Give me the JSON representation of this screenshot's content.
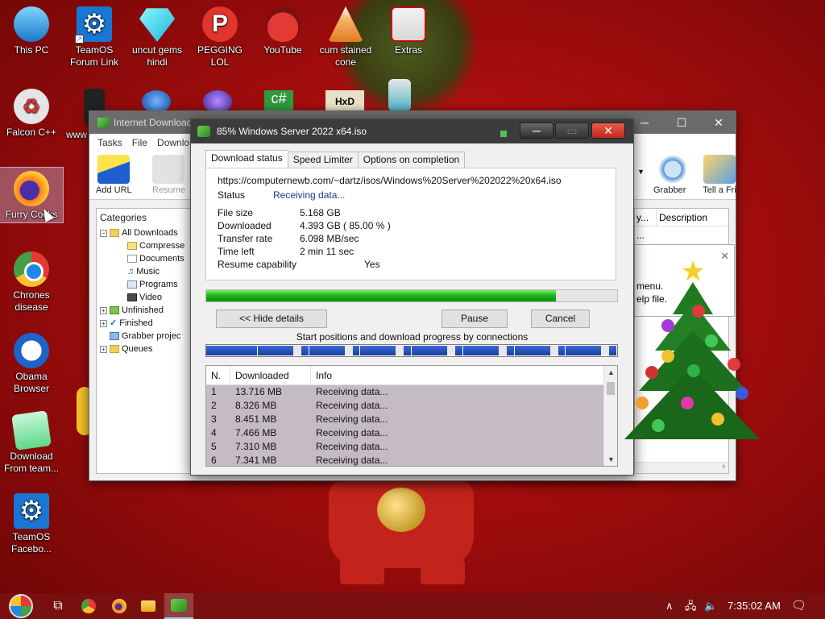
{
  "desktop": {
    "icons": [
      {
        "label": "This PC"
      },
      {
        "label": "TeamOS Forum Link"
      },
      {
        "label": "uncut gems hindi"
      },
      {
        "label": "PEGGING LOL"
      },
      {
        "label": "YouTube"
      },
      {
        "label": "cum stained cone"
      },
      {
        "label": "Extras"
      },
      {
        "label": "Falcon C++"
      },
      {
        "label": "www"
      },
      {
        "label": "Furry Cocks"
      },
      {
        "label": "Chrones disease"
      },
      {
        "label": "Obama Browser"
      },
      {
        "label": "Download From team..."
      },
      {
        "label": "TeamOS Facebo..."
      }
    ]
  },
  "idm": {
    "title": "Internet Download",
    "menu": [
      "Tasks",
      "File",
      "Downlo"
    ],
    "toolbar": {
      "add_url": "Add URL",
      "resume": "Resume",
      "grabber": "Grabber",
      "tell": "Tell a Fri"
    },
    "categories": {
      "header": "Categories",
      "items": [
        "All Downloads",
        "Compresse",
        "Documents",
        "Music",
        "Programs",
        "Video",
        "Unfinished",
        "Finished",
        "Grabber projec",
        "Queues"
      ]
    },
    "list_header_trunc": "y...",
    "list_dots": "...",
    "description_header": "Description",
    "popup_text_1": "menu.",
    "popup_text_2": "elp file."
  },
  "dialog": {
    "title": "85% Windows Server 2022 x64.iso",
    "tabs": [
      "Download status",
      "Speed Limiter",
      "Options on completion"
    ],
    "url": "https://computernewb.com/~dartz/isos/Windows%20Server%202022%20x64.iso",
    "status_label": "Status",
    "status_value": "Receiving data...",
    "file_size_label": "File size",
    "file_size_value": "5.168  GB",
    "downloaded_label": "Downloaded",
    "downloaded_value": "4.393  GB  ( 85.00 % )",
    "transfer_rate_label": "Transfer rate",
    "transfer_rate_value": "6.098  MB/sec",
    "time_left_label": "Time left",
    "time_left_value": "2 min 11 sec",
    "resume_label": "Resume capability",
    "resume_value": "Yes",
    "progress": 0.85,
    "hide_details": "<< Hide details",
    "pause": "Pause",
    "cancel": "Cancel",
    "connections_label": "Start positions and download progress by connections",
    "table_headers": {
      "n": "N.",
      "downloaded": "Downloaded",
      "info": "Info"
    },
    "connections": [
      {
        "n": "1",
        "downloaded": "13.716  MB",
        "info": "Receiving data..."
      },
      {
        "n": "2",
        "downloaded": "8.326  MB",
        "info": "Receiving data..."
      },
      {
        "n": "3",
        "downloaded": "8.451  MB",
        "info": "Receiving data..."
      },
      {
        "n": "4",
        "downloaded": "7.466  MB",
        "info": "Receiving data..."
      },
      {
        "n": "5",
        "downloaded": "7.310  MB",
        "info": "Receiving data..."
      },
      {
        "n": "6",
        "downloaded": "7.341  MB",
        "info": "Receiving data..."
      }
    ]
  },
  "taskbar": {
    "clock": "7:35:02 AM"
  },
  "colors": {
    "wallpaper": "#c41515",
    "progress_green": "#1fb81a",
    "connection_blue": "#1b3f9e",
    "row_selected": "#c5bcc3",
    "taskbar": "#7a0f0f"
  }
}
